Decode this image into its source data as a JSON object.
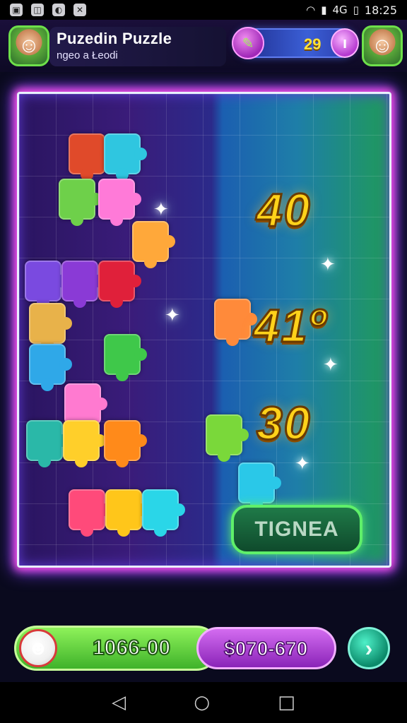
{
  "status_bar": {
    "time": "18:25",
    "signal_text": "4G",
    "left_icons": [
      "image-icon",
      "screenshot-icon",
      "toggle-icon",
      "bug-icon"
    ]
  },
  "header": {
    "title": "Puzedin Puzzle",
    "subtitle": "ngeo a Łeodi",
    "score": "29",
    "left_button_icon": "wand-icon",
    "right_button_icon": "info-icon"
  },
  "board": {
    "numbers": [
      "40",
      "41º",
      "30"
    ],
    "button_label": "TIGNEA"
  },
  "bottom": {
    "coins": "1066-00",
    "gems": "$070-670",
    "next_icon": "arrow-right-icon"
  },
  "navbar": {
    "back": "◁",
    "home": "○",
    "recent": "□"
  },
  "colors": {
    "accent_green": "#5ff06a",
    "accent_pink": "#ff4fe0",
    "number_gold": "#ffd21a",
    "board_border": "#e9f0ff"
  }
}
